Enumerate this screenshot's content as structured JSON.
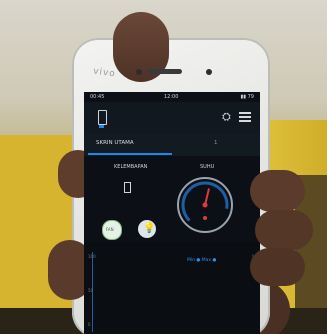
{
  "photo": {
    "device_brand": "vivo",
    "colors": {
      "wall": "#d6b430",
      "skin": "#5a3a2a",
      "screen": "#0c1016",
      "accent": "#1e88e5",
      "needle": "#e53935"
    }
  },
  "app": {
    "status": {
      "left": "00:45",
      "time": "12:00",
      "right": "▮▮ 79"
    },
    "tabs": [
      {
        "label": "SKRIN UTAMA",
        "active": true
      },
      {
        "label": "1",
        "active": false
      }
    ],
    "sections": {
      "left_title": "KELEMBAPAN",
      "right_title": "SUHU"
    },
    "gauge": {
      "value_fraction": 0.55
    },
    "buttons": [
      {
        "icon": "fan-icon",
        "label": "FAN"
      },
      {
        "icon": "lightbulb-icon"
      }
    ],
    "graph": {
      "legend": "Min ● Max ●",
      "axis_labels": [
        "100",
        "50",
        "0"
      ]
    },
    "icons": [
      "phone-icon",
      "tools-icon",
      "menu-icon",
      "kebab-icon"
    ]
  }
}
